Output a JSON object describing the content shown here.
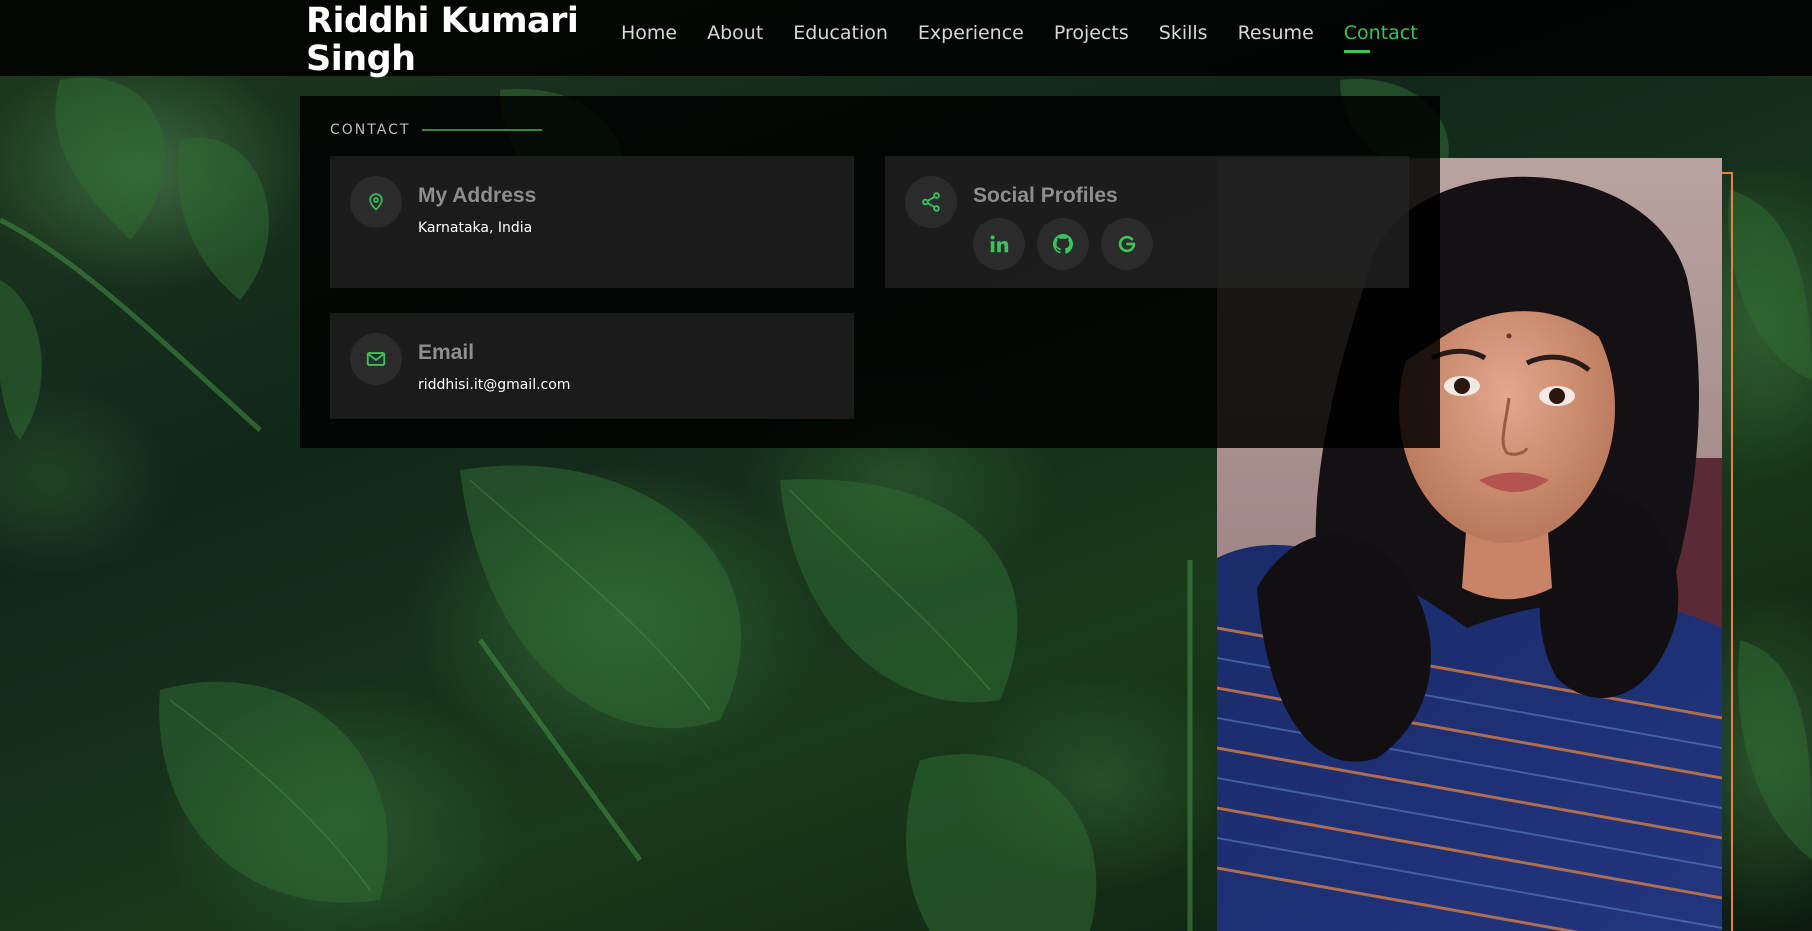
{
  "header": {
    "brand": "Riddhi Kumari Singh",
    "nav": [
      {
        "label": "Home"
      },
      {
        "label": "About"
      },
      {
        "label": "Education"
      },
      {
        "label": "Experience"
      },
      {
        "label": "Projects"
      },
      {
        "label": "Skills"
      },
      {
        "label": "Resume"
      },
      {
        "label": "Contact",
        "active": true
      }
    ]
  },
  "contact": {
    "section_label": "CONTACT",
    "address": {
      "title": "My Address",
      "value": "Karnataka, India",
      "icon": "map-pin-icon"
    },
    "social": {
      "title": "Social Profiles",
      "icon": "share-icon",
      "profiles": [
        {
          "icon": "linkedin-icon"
        },
        {
          "icon": "github-icon"
        },
        {
          "icon": "google-icon"
        }
      ]
    },
    "email": {
      "title": "Email",
      "value": "riddhisi.it@gmail.com",
      "icon": "envelope-icon"
    }
  },
  "colors": {
    "accent": "#3cc25a",
    "frame": "#e8823a"
  }
}
